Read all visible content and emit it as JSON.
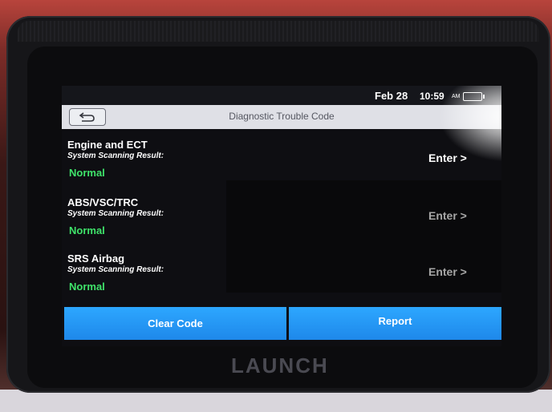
{
  "status_bar": {
    "date": "Feb 28",
    "time": "10:59",
    "ampm": "AM"
  },
  "title_bar": {
    "title": "Diagnostic Trouble Code"
  },
  "systems": [
    {
      "name": "Engine and ECT",
      "scan_label": "System Scanning Result:",
      "status": "Normal",
      "enter_label": "Enter >"
    },
    {
      "name": "ABS/VSC/TRC",
      "scan_label": "System Scanning Result:",
      "status": "Normal",
      "enter_label": "Enter >"
    },
    {
      "name": "SRS Airbag",
      "scan_label": "System Scanning Result:",
      "status": "Normal",
      "enter_label": "Enter >"
    }
  ],
  "actions": {
    "clear_code": "Clear Code",
    "report": "Report"
  },
  "device": {
    "brand": "LAUNCH"
  },
  "colors": {
    "accent": "#1e88ea",
    "status_normal": "#3fe36a",
    "title_bar": "#dfe0e6"
  },
  "icons": {
    "back": "back-arrow-icon",
    "battery": "battery-icon"
  }
}
